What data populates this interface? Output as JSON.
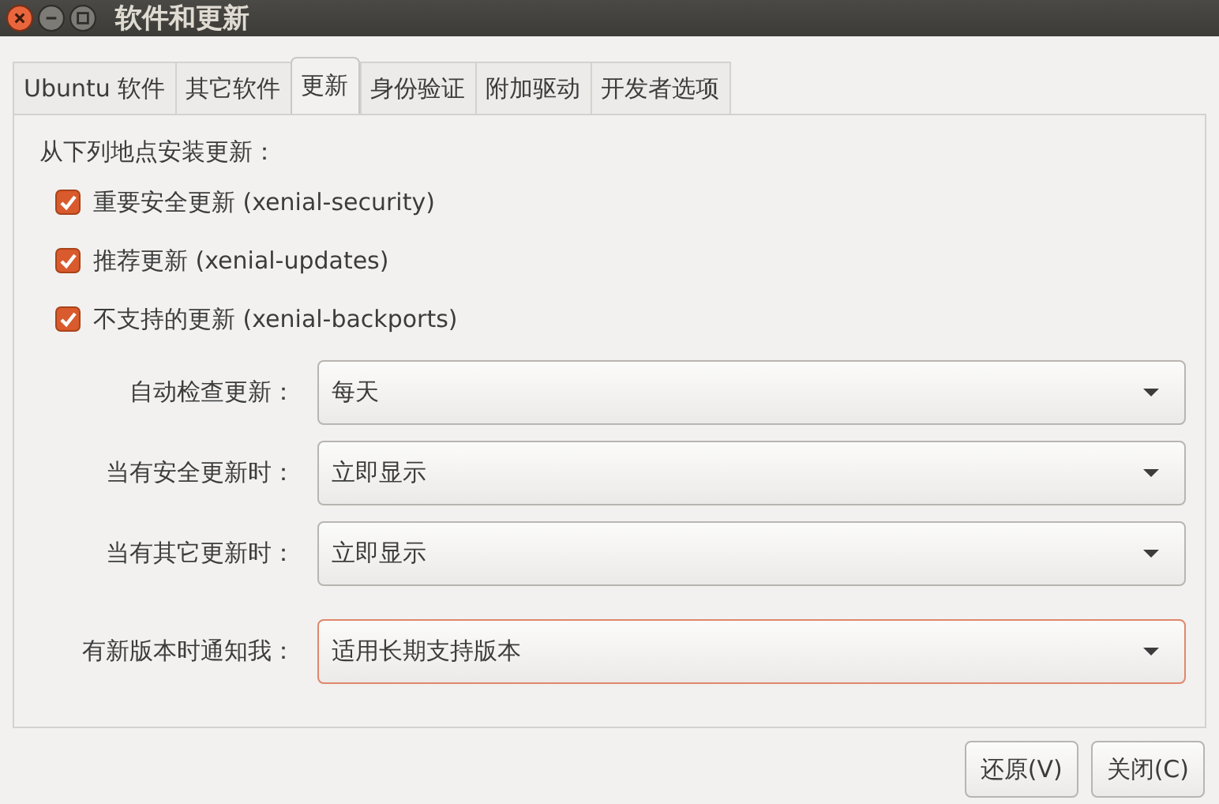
{
  "window": {
    "title": "软件和更新"
  },
  "tabs": [
    {
      "label": "Ubuntu 软件",
      "selected": false
    },
    {
      "label": "其它软件",
      "selected": false
    },
    {
      "label": "更新",
      "selected": true
    },
    {
      "label": "身份验证",
      "selected": false
    },
    {
      "label": "附加驱动",
      "selected": false
    },
    {
      "label": "开发者选项",
      "selected": false
    }
  ],
  "sources_heading": "从下列地点安装更新：",
  "sources": [
    {
      "label": "重要安全更新 (xenial-security)",
      "checked": true
    },
    {
      "label": "推荐更新 (xenial-updates)",
      "checked": true
    },
    {
      "label": "不支持的更新 (xenial-backports)",
      "checked": true
    }
  ],
  "settings": [
    {
      "label": "自动检查更新：",
      "value": "每天",
      "focused": false
    },
    {
      "label": "当有安全更新时：",
      "value": "立即显示",
      "focused": false
    },
    {
      "label": "当有其它更新时：",
      "value": "立即显示",
      "focused": false
    },
    {
      "label": "有新版本时通知我：",
      "value": "适用长期支持版本",
      "focused": true
    }
  ],
  "buttons": [
    "还原(V)",
    "关闭(C)"
  ]
}
